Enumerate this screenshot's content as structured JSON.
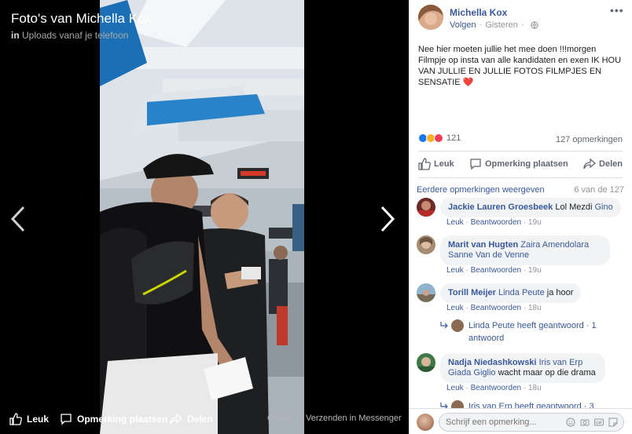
{
  "viewer": {
    "title": "Foto's van Michella Kox",
    "subtitle_in": "in",
    "subtitle_album": "Uploads vanaf je telefoon"
  },
  "bottom_bar": {
    "like": "Leuk",
    "comment": "Opmerking plaatsen",
    "share": "Delen",
    "options": "Opties",
    "messenger": "Verzenden in Messenger"
  },
  "post": {
    "author": "Michella Kox",
    "follow": "Volgen",
    "time": "Gisteren",
    "text": "Nee hier moeten jullie het mee doen !!!morgen Filmpje op insta van alle kandidaten en exen IK HOU VAN JULLIE EN JULLIE FOTOS FILMPJES EN SENSATIE",
    "emoji": "❤️",
    "reaction_count": "121",
    "comment_count": "127 opmerkingen",
    "actions": {
      "like": "Leuk",
      "comment": "Opmerking plaatsen",
      "share": "Delen"
    }
  },
  "comments_header": {
    "earlier": "Eerdere opmerkingen weergeven",
    "count": "6 van de 127"
  },
  "comments": [
    {
      "author": "Jackie Lauren Groesbeek",
      "body_pre": "",
      "tag": "",
      "body": "Lol Mezdi",
      "tag2": "Gino",
      "reply": "Leuk",
      "answer": "Beantwoorden",
      "time": "19u"
    },
    {
      "author": "Marit van Hugten",
      "tag": "Zaira Amendolara Sanne Van de Venne",
      "reply": "Leuk",
      "answer": "Beantwoorden",
      "time": "19u"
    },
    {
      "author": "Torill Meijer",
      "tag": "Linda Peute",
      "body": "ja hoor",
      "reply": "Leuk",
      "answer": "Beantwoorden",
      "time": "18u",
      "replies": "Linda Peute heeft geantwoord · 1 antwoord"
    },
    {
      "author": "Nadja Niedashkowski",
      "tag": "Iris van Erp Giada Giglio",
      "body": "wacht maar op die drama",
      "reply": "Leuk",
      "answer": "Beantwoorden",
      "time": "18u",
      "replies": "Iris van Erp heeft geantwoord · 3"
    }
  ],
  "composer": {
    "placeholder": "Schrijf een opmerking..."
  },
  "colors": {
    "link": "#385898",
    "muted": "#90949c",
    "bubble": "#f2f3f5"
  }
}
